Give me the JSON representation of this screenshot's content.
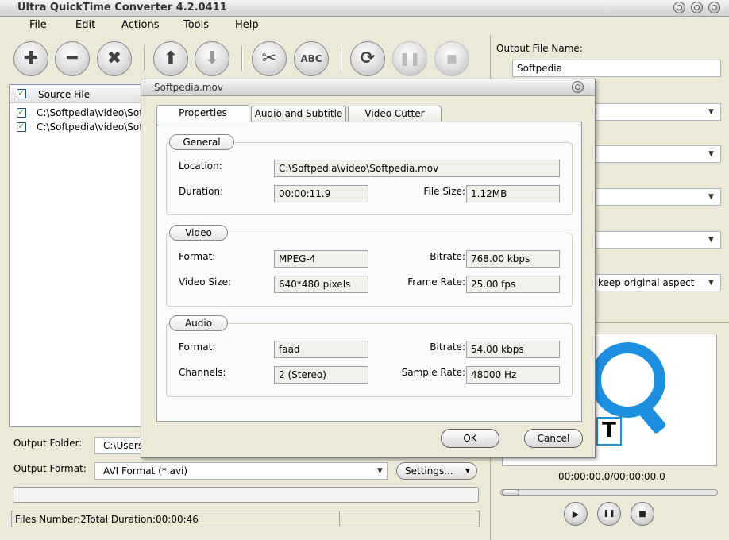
{
  "window": {
    "title": "Ultra QuickTime Converter 4.2.0411"
  },
  "menu": [
    "File",
    "Edit",
    "Actions",
    "Tools",
    "Help"
  ],
  "toolbar": {
    "abc_label": "ABC"
  },
  "file_list": {
    "header": "Source File",
    "rows": [
      {
        "path": "C:\\Softpedia\\video\\Soft"
      },
      {
        "path": "C:\\Softpedia\\video\\Soft"
      }
    ]
  },
  "output": {
    "folder_label": "Output Folder:",
    "folder_value": "C:\\Users",
    "format_label": "Output Format:",
    "format_value": "AVI Format (*.avi)",
    "settings_label": "Settings..."
  },
  "status": {
    "files": "Files Number:2",
    "duration": "Total Duration:00:00:46"
  },
  "right_panel": {
    "output_name_label": "Output File Name:",
    "output_name_value": "Softpedia",
    "aspect_value": "keep original aspect",
    "preview_glyph": "T",
    "time_readout": "00:00:00.0/00:00:00.0"
  },
  "dialog": {
    "title": "Softpedia.mov",
    "tabs": [
      "Properties",
      "Audio and Subtitle",
      "Video Cutter"
    ],
    "general": {
      "legend": "General",
      "location_label": "Location:",
      "location": "C:\\Softpedia\\video\\Softpedia.mov",
      "duration_label": "Duration:",
      "duration": "00:00:11.9",
      "filesize_label": "File Size:",
      "filesize": "1.12MB"
    },
    "video": {
      "legend": "Video",
      "format_label": "Format:",
      "format": "MPEG-4",
      "bitrate_label": "Bitrate:",
      "bitrate": "768.00 kbps",
      "size_label": "Video Size:",
      "size": "640*480 pixels",
      "framerate_label": "Frame Rate:",
      "framerate": "25.00 fps"
    },
    "audio": {
      "legend": "Audio",
      "format_label": "Format:",
      "format": "faad",
      "bitrate_label": "Bitrate:",
      "bitrate": "54.00 kbps",
      "channels_label": "Channels:",
      "channels": "2 (Stereo)",
      "samplerate_label": "Sample Rate:",
      "samplerate": "48000 Hz"
    },
    "ok_label": "OK",
    "cancel_label": "Cancel"
  },
  "colors": {
    "accent_blue": "#1e8fe0",
    "check_green": "#219a21"
  }
}
